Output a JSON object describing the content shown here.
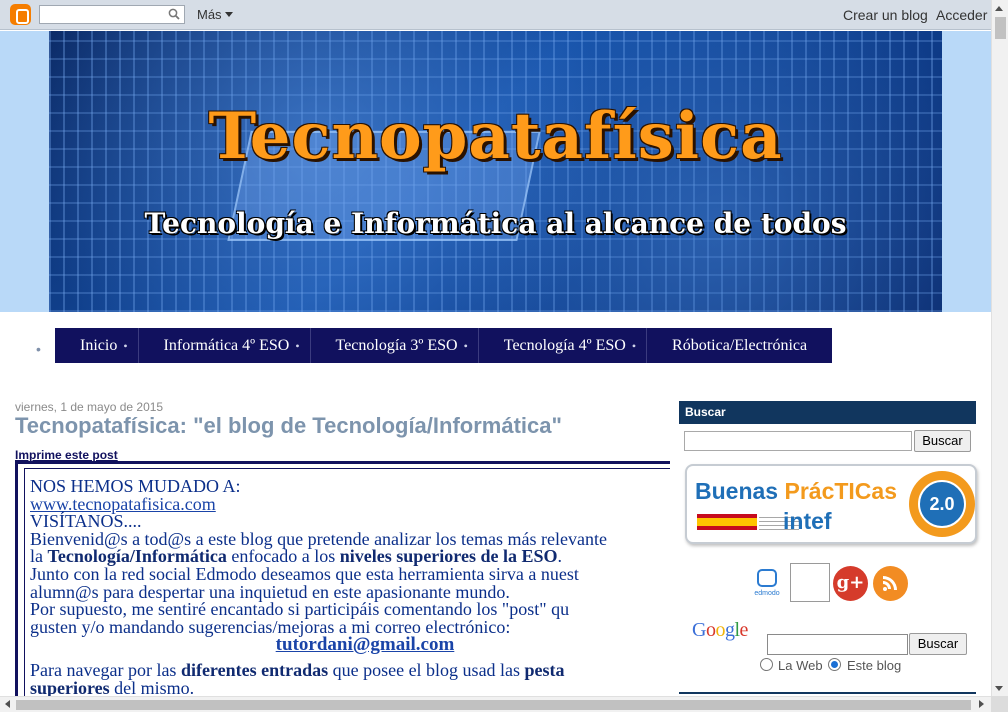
{
  "navbar": {
    "search_value": "",
    "mas_label": "Más",
    "crear_blog": "Crear un blog",
    "acceder": "Acceder"
  },
  "header": {
    "title": "Tecnopatafísica",
    "subtitle": "Tecnología e Informática al alcance de todos"
  },
  "tabs": [
    {
      "label": "Inicio"
    },
    {
      "label": "Informática 4º ESO"
    },
    {
      "label": "Tecnología 3º ESO"
    },
    {
      "label": "Tecnología 4º ESO"
    },
    {
      "label": "Róbotica/Electrónica"
    }
  ],
  "post": {
    "date": "viernes, 1 de mayo de 2015",
    "title": "Tecnopatafísica: \"el blog de Tecnología/Informática\"",
    "print_link": "Imprime este post",
    "lines": {
      "l1": "NOS HEMOS MUDADO A:",
      "l2": "www.tecnopatafisica.com",
      "l3": "VISÍTANOS....",
      "l4a": "Bienvenid@s a tod@s a este blog que pretende analizar los temas más relevante",
      "l5a": "la ",
      "l5b": "Tecnología/Informática",
      "l5c": " enfocado a los ",
      "l5d": "niveles superiores de la ESO",
      "l5e": ".",
      "l6": "Junto con la red social Edmodo deseamos que esta herramienta sirva a nuest",
      "l7": "alumn@s para despertar una inquietud en este apasionante mundo.",
      "l8": "Por supuesto, me sentiré encantado si participáis comentando los \"post\" qu",
      "l9": "gusten y/o mandando sugerencias/mejoras a mi correo electrónico:",
      "email": "tutordani@gmail.com",
      "l10a": "Para navegar por las ",
      "l10b": "diferentes entradas",
      "l10c": " que posee el blog usad las ",
      "l10d": "pesta",
      "l11a": "superiores",
      "l11b": " del mismo."
    }
  },
  "sidebar": {
    "search_head": "Buscar",
    "search_value": "",
    "search_button": "Buscar",
    "badge": {
      "title_a": "Buenas ",
      "title_b": "PrácTICas",
      "intef": "intef",
      "version": "2.0"
    },
    "edmodo_label": "edmodo",
    "gplus_label": "g+",
    "google_search": {
      "value": "",
      "button": "Buscar",
      "option_web": "La Web",
      "option_blog": "Este blog",
      "selected": "Este blog"
    }
  },
  "colors": {
    "tab_bg": "#11115e",
    "title_blue": "#7d94ad",
    "banner_orange": "#ff9b1a"
  }
}
